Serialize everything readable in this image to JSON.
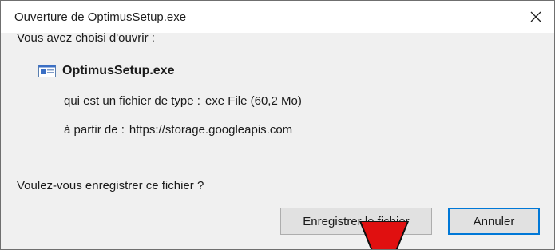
{
  "window": {
    "title": "Ouverture de OptimusSetup.exe",
    "close_icon": "close-icon"
  },
  "dialog": {
    "intro": "Vous avez choisi d'ouvrir :",
    "file_icon": "exe-file-icon",
    "file_name": "OptimusSetup.exe",
    "type_label": "qui est un fichier de type :",
    "type_value": "exe File (60,2 Mo)",
    "source_label": "à partir de :",
    "source_value": "https://storage.googleapis.com",
    "question": "Voulez-vous enregistrer ce fichier ?"
  },
  "buttons": {
    "save": "Enregistrer le fichier",
    "cancel": "Annuler"
  },
  "annotation": {
    "arrow_color": "#e01010"
  }
}
